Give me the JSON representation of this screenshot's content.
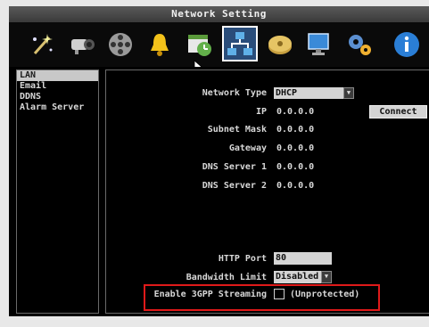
{
  "window": {
    "title": "Network Setting"
  },
  "toolbar": {
    "icons": [
      {
        "name": "wizard-wand-icon"
      },
      {
        "name": "camera-icon"
      },
      {
        "name": "film-reel-icon"
      },
      {
        "name": "alarm-bell-icon"
      },
      {
        "name": "schedule-clock-icon"
      },
      {
        "name": "network-icon",
        "selected": true
      },
      {
        "name": "hard-disk-icon"
      },
      {
        "name": "monitor-icon"
      },
      {
        "name": "system-gears-icon"
      },
      {
        "name": "info-icon"
      }
    ]
  },
  "sidebar": {
    "items": [
      {
        "label": "LAN",
        "active": true
      },
      {
        "label": "Email"
      },
      {
        "label": "DDNS"
      },
      {
        "label": "Alarm Server"
      }
    ]
  },
  "form": {
    "network_type": {
      "label": "Network Type",
      "value": "DHCP"
    },
    "ip": {
      "label": "IP",
      "value": "0.0.0.0"
    },
    "connect_button": "Connect",
    "subnet_mask": {
      "label": "Subnet Mask",
      "value": "0.0.0.0"
    },
    "gateway": {
      "label": "Gateway",
      "value": "0.0.0.0"
    },
    "dns1": {
      "label": "DNS Server 1",
      "value": "0.0.0.0"
    },
    "dns2": {
      "label": "DNS Server 2",
      "value": "0.0.0.0"
    },
    "http_port": {
      "label": "HTTP Port",
      "value": "80"
    },
    "bandwidth_limit": {
      "label": "Bandwidth Limit",
      "value": "Disabled"
    },
    "gpp_streaming": {
      "label": "Enable 3GPP Streaming",
      "checked": false,
      "note": "(Unprotected)"
    }
  },
  "colors": {
    "highlight": "#e01a1a",
    "selected_icon_bg": "#2a4d7a",
    "field_bg": "#d4d4d4"
  }
}
